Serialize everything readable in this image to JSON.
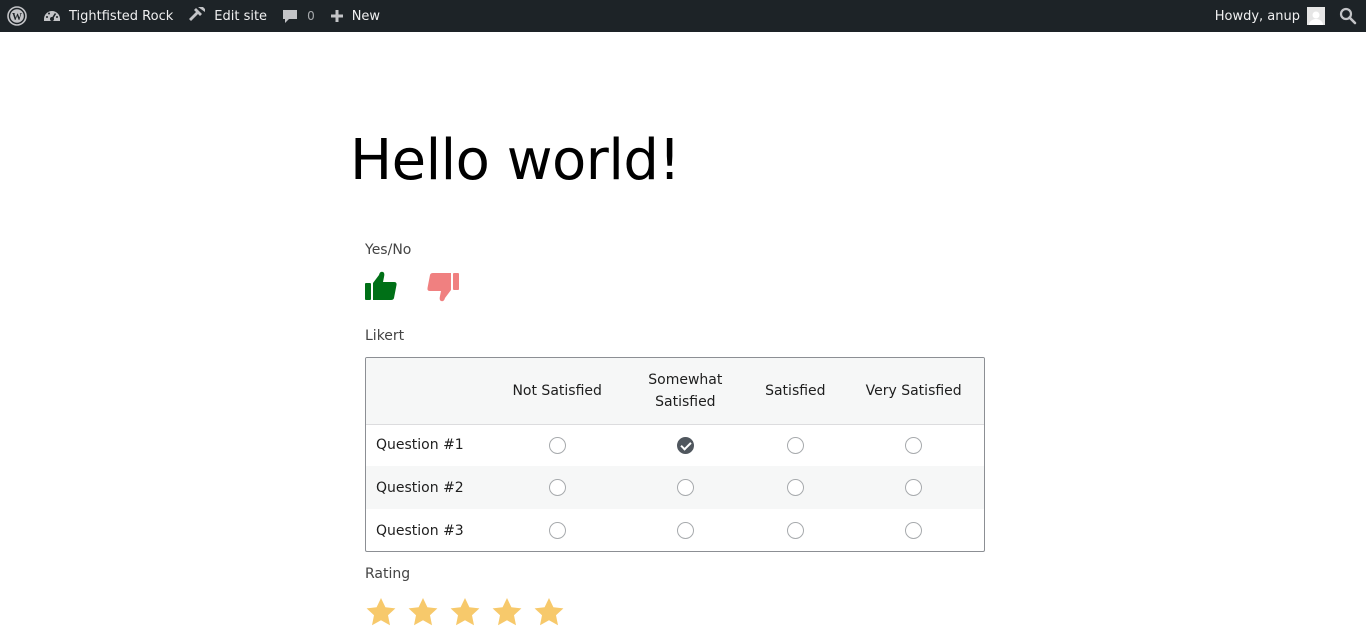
{
  "adminbar": {
    "site_name": "Tightfisted Rock",
    "edit_site": "Edit site",
    "comments_count": "0",
    "new_label": "New",
    "howdy": "Howdy, anup"
  },
  "page": {
    "title": "Hello world!"
  },
  "yesno": {
    "label": "Yes/No",
    "thumbs_up_color": "#007017",
    "thumbs_down_color": "#f08080"
  },
  "likert": {
    "label": "Likert",
    "columns": [
      "Not Satisfied",
      "Somewhat Satisfied",
      "Satisfied",
      "Very Satisfied"
    ],
    "rows": [
      {
        "question": "Question #1",
        "selected": 1
      },
      {
        "question": "Question #2",
        "selected": null
      },
      {
        "question": "Question #3",
        "selected": null
      }
    ]
  },
  "rating": {
    "label": "Rating",
    "max_stars": 5,
    "star_color": "#f7c96b"
  }
}
